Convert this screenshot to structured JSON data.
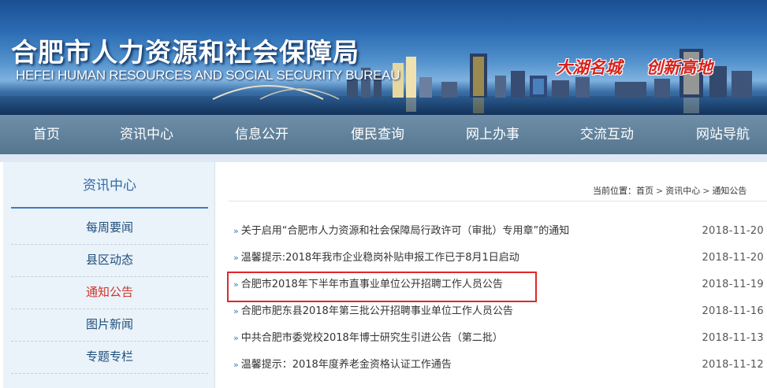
{
  "header": {
    "title": "合肥市人力资源和社会保障局",
    "subtitle": "HEFEI HUMAN RESOURCES AND SOCIAL SECURITY BUREAU",
    "slogan_1": "大湖名城",
    "slogan_2": "创新高地"
  },
  "nav": {
    "items": [
      "首页",
      "资讯中心",
      "信息公开",
      "便民查询",
      "网上办事",
      "交流互动",
      "网站导航"
    ]
  },
  "sidebar": {
    "title": "资讯中心",
    "items": [
      "每周要闻",
      "县区动态",
      "通知公告",
      "图片新闻",
      "专题专栏"
    ],
    "active_index": 2,
    "active_color": "#d0362c"
  },
  "breadcrumb": {
    "prefix": "当前位置：",
    "items": [
      "首页",
      "资讯中心",
      "通知公告"
    ],
    "separator": ">"
  },
  "news": [
    {
      "title": "关于启用“合肥市人力资源和社会保障局行政许可（审批）专用章”的通知",
      "date": "2018-11-20"
    },
    {
      "title": "温馨提示:2018年我市企业稳岗补贴申报工作已于8月1日启动",
      "date": "2018-11-20"
    },
    {
      "title": "合肥市2018年下半年市直事业单位公开招聘工作人员公告",
      "date": "2018-11-19"
    },
    {
      "title": "合肥市肥东县2018年第三批公开招聘事业单位工作人员公告",
      "date": "2018-11-16"
    },
    {
      "title": "中共合肥市委党校2018年博士研究生引进公告（第二批）",
      "date": "2018-11-13"
    },
    {
      "title": "温馨提示：2018年度养老金资格认证工作通告",
      "date": "2018-11-12"
    }
  ],
  "highlighted_index": 2,
  "colors": {
    "nav_bg": "#6283a0",
    "accent": "#3f7bc0",
    "highlight_border": "#e0262c"
  }
}
